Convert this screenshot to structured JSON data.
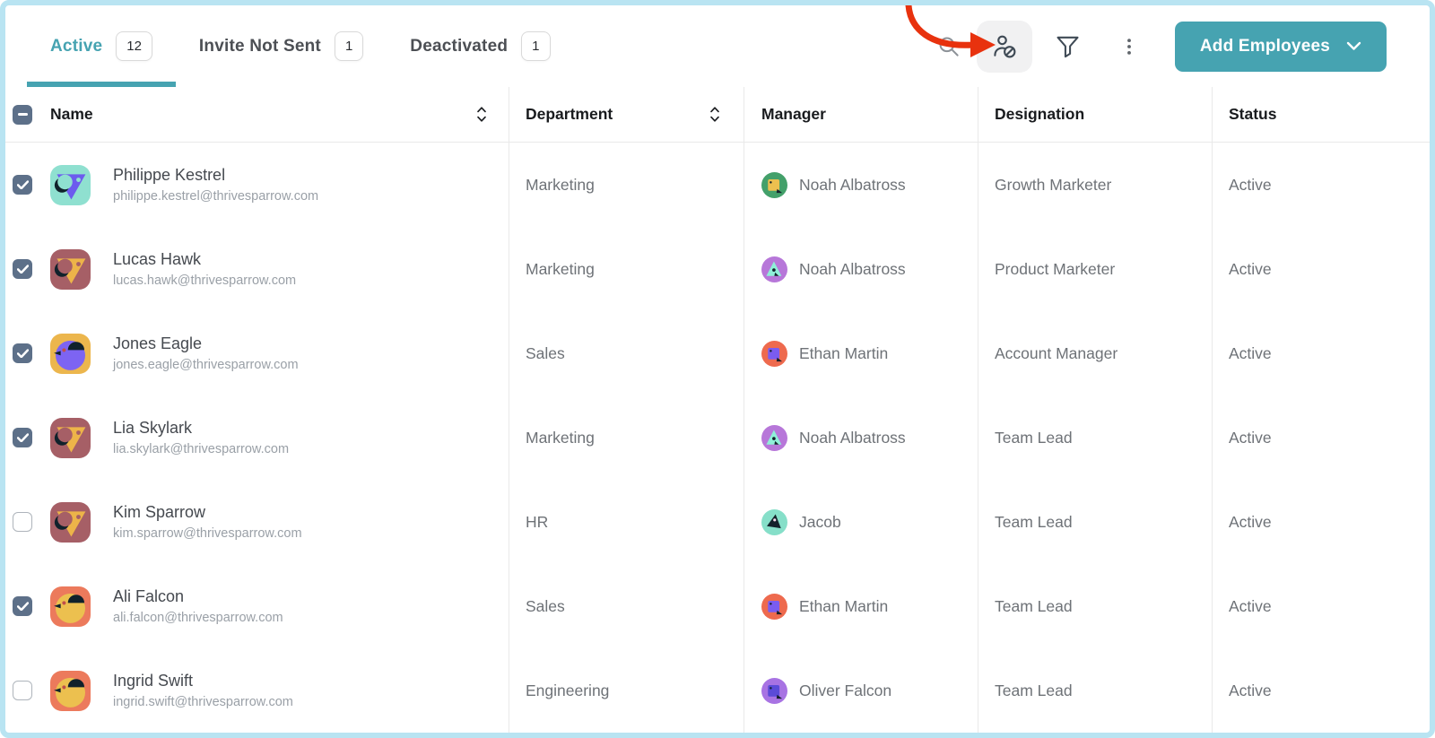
{
  "colors": {
    "accent": "#46a3b1",
    "frame-border": "#b9e4f2",
    "table-line": "#e9e9e9",
    "checkbox-fill": "#5d7089",
    "arrow": "#e8320e"
  },
  "tabs": [
    {
      "label": "Active",
      "count": "12",
      "active": true
    },
    {
      "label": "Invite Not Sent",
      "count": "1",
      "active": false
    },
    {
      "label": "Deactivated",
      "count": "1",
      "active": false
    }
  ],
  "toolbar": {
    "add_button_label": "Add Employees",
    "icon_buttons": [
      "search",
      "deactivate-user",
      "filter",
      "more-options"
    ],
    "annotation": "red arrow pointing at deactivate-user icon"
  },
  "table": {
    "select_all_state": "indeterminate",
    "columns": [
      {
        "label": "Name",
        "sortable": true
      },
      {
        "label": "Department",
        "sortable": true
      },
      {
        "label": "Manager",
        "sortable": false
      },
      {
        "label": "Designation",
        "sortable": false
      },
      {
        "label": "Status",
        "sortable": false
      }
    ],
    "rows": [
      {
        "name": "Philippe Kestrel",
        "email": "philippe.kestrel@thrivesparrow.com",
        "checked": true,
        "department": "Marketing",
        "designation": "Growth Marketer",
        "status": "Active",
        "avatar": {
          "bg": "#8fe0d0",
          "fg": "#6c5bee",
          "shape": "triangle"
        },
        "manager": {
          "name": "Noah Albatross",
          "avatar": {
            "bg": "#43a06a",
            "fg": "#ecc04f",
            "shape": "square"
          }
        }
      },
      {
        "name": "Lucas Hawk",
        "email": "lucas.hawk@thrivesparrow.com",
        "checked": true,
        "department": "Marketing",
        "designation": "Product Marketer",
        "status": "Active",
        "avatar": {
          "bg": "#a65f66",
          "fg": "#edb449",
          "shape": "triangle"
        },
        "manager": {
          "name": "Noah Albatross",
          "avatar": {
            "bg": "#b777d9",
            "fg": "#8ff0d8",
            "shape": "triangle"
          }
        }
      },
      {
        "name": "Jones Eagle",
        "email": "jones.eagle@thrivesparrow.com",
        "checked": true,
        "department": "Sales",
        "designation": "Account Manager",
        "status": "Active",
        "avatar": {
          "bg": "#ecb64d",
          "fg": "#7d64f2",
          "shape": "round"
        },
        "manager": {
          "name": "Ethan Martin",
          "avatar": {
            "bg": "#ee6a4e",
            "fg": "#7a5cf0",
            "shape": "square"
          }
        }
      },
      {
        "name": "Lia Skylark",
        "email": "lia.skylark@thrivesparrow.com",
        "checked": true,
        "department": "Marketing",
        "designation": "Team Lead",
        "status": "Active",
        "avatar": {
          "bg": "#a65f66",
          "fg": "#edb449",
          "shape": "triangle"
        },
        "manager": {
          "name": "Noah Albatross",
          "avatar": {
            "bg": "#b777d9",
            "fg": "#8ff0d8",
            "shape": "triangle"
          }
        }
      },
      {
        "name": "Kim Sparrow",
        "email": "kim.sparrow@thrivesparrow.com",
        "checked": false,
        "department": "HR",
        "designation": "Team Lead",
        "status": "Active",
        "avatar": {
          "bg": "#a65f66",
          "fg": "#edb449",
          "shape": "triangle"
        },
        "manager": {
          "name": "Jacob",
          "avatar": {
            "bg": "#86dfc9",
            "fg": "#14212b",
            "shape": "bird"
          }
        }
      },
      {
        "name": "Ali Falcon",
        "email": "ali.falcon@thrivesparrow.com",
        "checked": true,
        "department": "Sales",
        "designation": "Team Lead",
        "status": "Active",
        "avatar": {
          "bg": "#ec7a5c",
          "fg": "#ecc04f",
          "shape": "round"
        },
        "manager": {
          "name": "Ethan Martin",
          "avatar": {
            "bg": "#ee6a4e",
            "fg": "#7a5cf0",
            "shape": "square"
          }
        }
      },
      {
        "name": "Ingrid Swift",
        "email": "ingrid.swift@thrivesparrow.com",
        "checked": false,
        "department": "Engineering",
        "designation": "Team Lead",
        "status": "Active",
        "avatar": {
          "bg": "#ec7a5c",
          "fg": "#ecc04f",
          "shape": "round"
        },
        "manager": {
          "name": "Oliver Falcon",
          "avatar": {
            "bg": "#a873e3",
            "fg": "#5b4bd8",
            "shape": "square"
          }
        }
      }
    ]
  }
}
